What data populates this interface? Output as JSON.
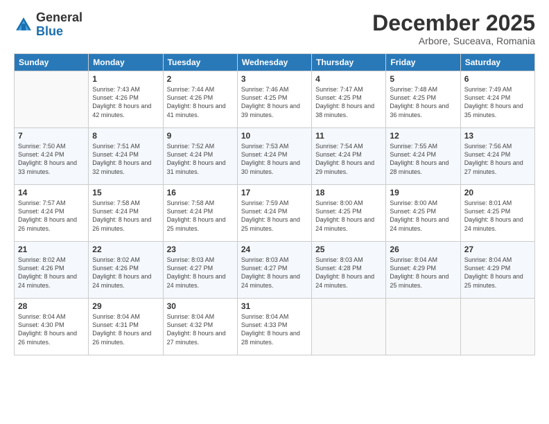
{
  "logo": {
    "general": "General",
    "blue": "Blue"
  },
  "header": {
    "month": "December 2025",
    "location": "Arbore, Suceava, Romania"
  },
  "days_of_week": [
    "Sunday",
    "Monday",
    "Tuesday",
    "Wednesday",
    "Thursday",
    "Friday",
    "Saturday"
  ],
  "weeks": [
    [
      {
        "day": "",
        "sunrise": "",
        "sunset": "",
        "daylight": ""
      },
      {
        "day": "1",
        "sunrise": "Sunrise: 7:43 AM",
        "sunset": "Sunset: 4:26 PM",
        "daylight": "Daylight: 8 hours and 42 minutes."
      },
      {
        "day": "2",
        "sunrise": "Sunrise: 7:44 AM",
        "sunset": "Sunset: 4:26 PM",
        "daylight": "Daylight: 8 hours and 41 minutes."
      },
      {
        "day": "3",
        "sunrise": "Sunrise: 7:46 AM",
        "sunset": "Sunset: 4:25 PM",
        "daylight": "Daylight: 8 hours and 39 minutes."
      },
      {
        "day": "4",
        "sunrise": "Sunrise: 7:47 AM",
        "sunset": "Sunset: 4:25 PM",
        "daylight": "Daylight: 8 hours and 38 minutes."
      },
      {
        "day": "5",
        "sunrise": "Sunrise: 7:48 AM",
        "sunset": "Sunset: 4:25 PM",
        "daylight": "Daylight: 8 hours and 36 minutes."
      },
      {
        "day": "6",
        "sunrise": "Sunrise: 7:49 AM",
        "sunset": "Sunset: 4:24 PM",
        "daylight": "Daylight: 8 hours and 35 minutes."
      }
    ],
    [
      {
        "day": "7",
        "sunrise": "Sunrise: 7:50 AM",
        "sunset": "Sunset: 4:24 PM",
        "daylight": "Daylight: 8 hours and 33 minutes."
      },
      {
        "day": "8",
        "sunrise": "Sunrise: 7:51 AM",
        "sunset": "Sunset: 4:24 PM",
        "daylight": "Daylight: 8 hours and 32 minutes."
      },
      {
        "day": "9",
        "sunrise": "Sunrise: 7:52 AM",
        "sunset": "Sunset: 4:24 PM",
        "daylight": "Daylight: 8 hours and 31 minutes."
      },
      {
        "day": "10",
        "sunrise": "Sunrise: 7:53 AM",
        "sunset": "Sunset: 4:24 PM",
        "daylight": "Daylight: 8 hours and 30 minutes."
      },
      {
        "day": "11",
        "sunrise": "Sunrise: 7:54 AM",
        "sunset": "Sunset: 4:24 PM",
        "daylight": "Daylight: 8 hours and 29 minutes."
      },
      {
        "day": "12",
        "sunrise": "Sunrise: 7:55 AM",
        "sunset": "Sunset: 4:24 PM",
        "daylight": "Daylight: 8 hours and 28 minutes."
      },
      {
        "day": "13",
        "sunrise": "Sunrise: 7:56 AM",
        "sunset": "Sunset: 4:24 PM",
        "daylight": "Daylight: 8 hours and 27 minutes."
      }
    ],
    [
      {
        "day": "14",
        "sunrise": "Sunrise: 7:57 AM",
        "sunset": "Sunset: 4:24 PM",
        "daylight": "Daylight: 8 hours and 26 minutes."
      },
      {
        "day": "15",
        "sunrise": "Sunrise: 7:58 AM",
        "sunset": "Sunset: 4:24 PM",
        "daylight": "Daylight: 8 hours and 26 minutes."
      },
      {
        "day": "16",
        "sunrise": "Sunrise: 7:58 AM",
        "sunset": "Sunset: 4:24 PM",
        "daylight": "Daylight: 8 hours and 25 minutes."
      },
      {
        "day": "17",
        "sunrise": "Sunrise: 7:59 AM",
        "sunset": "Sunset: 4:24 PM",
        "daylight": "Daylight: 8 hours and 25 minutes."
      },
      {
        "day": "18",
        "sunrise": "Sunrise: 8:00 AM",
        "sunset": "Sunset: 4:25 PM",
        "daylight": "Daylight: 8 hours and 24 minutes."
      },
      {
        "day": "19",
        "sunrise": "Sunrise: 8:00 AM",
        "sunset": "Sunset: 4:25 PM",
        "daylight": "Daylight: 8 hours and 24 minutes."
      },
      {
        "day": "20",
        "sunrise": "Sunrise: 8:01 AM",
        "sunset": "Sunset: 4:25 PM",
        "daylight": "Daylight: 8 hours and 24 minutes."
      }
    ],
    [
      {
        "day": "21",
        "sunrise": "Sunrise: 8:02 AM",
        "sunset": "Sunset: 4:26 PM",
        "daylight": "Daylight: 8 hours and 24 minutes."
      },
      {
        "day": "22",
        "sunrise": "Sunrise: 8:02 AM",
        "sunset": "Sunset: 4:26 PM",
        "daylight": "Daylight: 8 hours and 24 minutes."
      },
      {
        "day": "23",
        "sunrise": "Sunrise: 8:03 AM",
        "sunset": "Sunset: 4:27 PM",
        "daylight": "Daylight: 8 hours and 24 minutes."
      },
      {
        "day": "24",
        "sunrise": "Sunrise: 8:03 AM",
        "sunset": "Sunset: 4:27 PM",
        "daylight": "Daylight: 8 hours and 24 minutes."
      },
      {
        "day": "25",
        "sunrise": "Sunrise: 8:03 AM",
        "sunset": "Sunset: 4:28 PM",
        "daylight": "Daylight: 8 hours and 24 minutes."
      },
      {
        "day": "26",
        "sunrise": "Sunrise: 8:04 AM",
        "sunset": "Sunset: 4:29 PM",
        "daylight": "Daylight: 8 hours and 25 minutes."
      },
      {
        "day": "27",
        "sunrise": "Sunrise: 8:04 AM",
        "sunset": "Sunset: 4:29 PM",
        "daylight": "Daylight: 8 hours and 25 minutes."
      }
    ],
    [
      {
        "day": "28",
        "sunrise": "Sunrise: 8:04 AM",
        "sunset": "Sunset: 4:30 PM",
        "daylight": "Daylight: 8 hours and 26 minutes."
      },
      {
        "day": "29",
        "sunrise": "Sunrise: 8:04 AM",
        "sunset": "Sunset: 4:31 PM",
        "daylight": "Daylight: 8 hours and 26 minutes."
      },
      {
        "day": "30",
        "sunrise": "Sunrise: 8:04 AM",
        "sunset": "Sunset: 4:32 PM",
        "daylight": "Daylight: 8 hours and 27 minutes."
      },
      {
        "day": "31",
        "sunrise": "Sunrise: 8:04 AM",
        "sunset": "Sunset: 4:33 PM",
        "daylight": "Daylight: 8 hours and 28 minutes."
      },
      {
        "day": "",
        "sunrise": "",
        "sunset": "",
        "daylight": ""
      },
      {
        "day": "",
        "sunrise": "",
        "sunset": "",
        "daylight": ""
      },
      {
        "day": "",
        "sunrise": "",
        "sunset": "",
        "daylight": ""
      }
    ]
  ]
}
